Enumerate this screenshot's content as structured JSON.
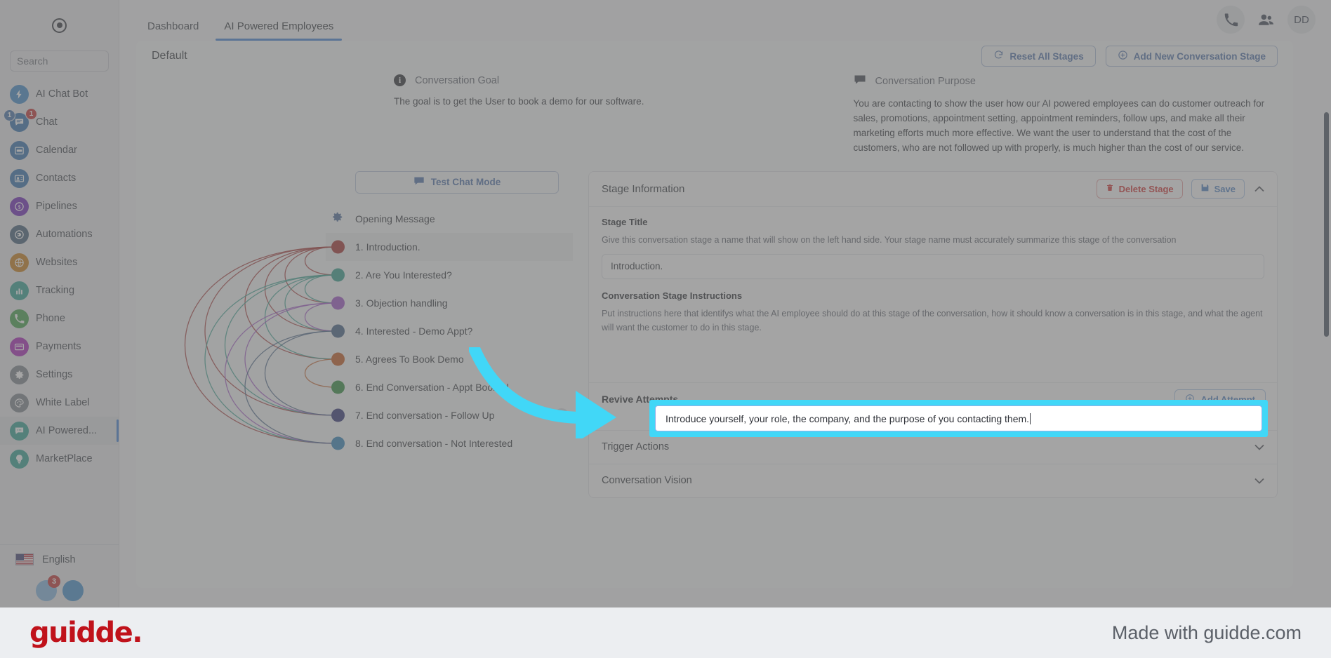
{
  "sidebar": {
    "search_placeholder": "Search",
    "logo_icon": "record-dot-icon",
    "items": [
      {
        "label": "AI Chat Bot",
        "icon": "bolt-icon",
        "color": "#3a86c8",
        "active": false
      },
      {
        "label": "Chat",
        "icon": "chat-bubble-icon",
        "color": "#2d6cab",
        "active": false,
        "badge_left": "1",
        "badge_right": "1"
      },
      {
        "label": "Calendar",
        "icon": "calendar-icon",
        "color": "#2d6cab",
        "active": false
      },
      {
        "label": "Contacts",
        "icon": "contact-card-icon",
        "color": "#2d6cab",
        "active": false
      },
      {
        "label": "Pipelines",
        "icon": "dollar-circle-icon",
        "color": "#6b21b6",
        "active": false
      },
      {
        "label": "Automations",
        "icon": "automation-icon",
        "color": "#3d5a74",
        "active": false
      },
      {
        "label": "Websites",
        "icon": "globe-icon",
        "color": "#c87a10",
        "active": false
      },
      {
        "label": "Tracking",
        "icon": "bar-chart-icon",
        "color": "#2a9d8f",
        "active": false
      },
      {
        "label": "Phone",
        "icon": "phone-icon",
        "color": "#3d9e46",
        "active": false
      },
      {
        "label": "Payments",
        "icon": "credit-card-icon",
        "color": "#a61fb5",
        "active": false
      },
      {
        "label": "Settings",
        "icon": "gear-icon",
        "color": "#7a8189",
        "active": false
      },
      {
        "label": "White Label",
        "icon": "palette-icon",
        "color": "#7a8189",
        "active": false
      },
      {
        "label": "AI Powered...",
        "icon": "chat-dots-icon",
        "color": "#2a9d8f",
        "active": true
      },
      {
        "label": "MarketPlace",
        "icon": "bulb-icon",
        "color": "#2a9d8f",
        "active": false
      }
    ],
    "language": "English",
    "language_flag": "us-flag-icon",
    "bottom_badge": "3"
  },
  "topbar": {
    "tabs": [
      {
        "label": "Dashboard",
        "active": false
      },
      {
        "label": "AI Powered Employees",
        "active": true
      }
    ],
    "phone_icon": "phone-icon",
    "people_icon": "people-icon",
    "avatar_initials": "DD"
  },
  "canvas": {
    "title": "Default",
    "reset_button": "Reset All Stages",
    "reset_icon": "refresh-icon",
    "add_stage_button": "Add New Conversation Stage",
    "add_stage_icon": "plus-circle-icon"
  },
  "goal": {
    "icon": "info-icon",
    "title": "Conversation Goal",
    "text": "The goal is to get the User to book a demo for our software."
  },
  "purpose": {
    "icon": "speech-bubble-icon",
    "title": "Conversation Purpose",
    "text": "You are contacting to show the user how our AI powered employees can do customer outreach for sales, promotions, appointment setting, appointment reminders, follow ups, and make all their marketing efforts much more effective. We want the user to understand that the cost of the customers, who are not followed up with properly, is much higher than the cost of our service."
  },
  "stages": {
    "test_chat_button": "Test Chat Mode",
    "test_chat_icon": "chat-bubble-icon",
    "opening": {
      "label": "Opening Message",
      "icon": "gear-icon"
    },
    "items": [
      {
        "label": "1. Introduction.",
        "color": "#a02a28",
        "selected": true
      },
      {
        "label": "2. Are You Interested?",
        "color": "#2d9c8a",
        "selected": false
      },
      {
        "label": "3. Objection handling",
        "color": "#9c4fc4",
        "selected": false
      },
      {
        "label": "4. Interested - Demo Appt?",
        "color": "#3d5c80",
        "selected": false
      },
      {
        "label": "5. Agrees To Book Demo",
        "color": "#c2561a",
        "selected": false
      },
      {
        "label": "6. End Conversation - Appt Booked",
        "color": "#2b8a38",
        "selected": false
      },
      {
        "label": "7. End conversation - Follow Up",
        "color": "#2c2d72",
        "selected": false,
        "bubble_icon": "chat-dots-icon"
      },
      {
        "label": "8. End conversation - Not Interested",
        "color": "#2d81b8",
        "selected": false
      }
    ]
  },
  "stage_info": {
    "panel_title": "Stage Information",
    "delete_button": "Delete Stage",
    "delete_icon": "trash-icon",
    "save_button": "Save",
    "save_icon": "floppy-disk-icon",
    "collapse_icon": "chevron-up-icon",
    "stage_title_label": "Stage Title",
    "stage_title_help": "Give this conversation stage a name that will show on the left hand side. Your stage name must accurately summarize this stage of the conversation",
    "stage_title_value": "Introduction.",
    "instructions_label": "Conversation Stage Instructions",
    "instructions_help": "Put instructions here that identifys what the AI employee should do at this stage of the conversation, how it should know a conversation is in this stage, and what the agent will want the customer to do in this stage.",
    "instructions_value": "Introduce yourself, your role, the company, and the purpose of you contacting them.",
    "revive_label": "Revive Attempts",
    "add_attempt_button": "Add Attempt",
    "add_attempt_icon": "plus-circle-icon",
    "trigger_actions_label": "Trigger Actions",
    "trigger_actions_icon": "chevron-down-icon",
    "conversation_vision_label": "Conversation Vision",
    "conversation_vision_icon": "chevron-down-icon"
  },
  "footer": {
    "logo_text": "guidde.",
    "made_with": "Made with guidde.com"
  },
  "highlight": {
    "color": "#41d7f7",
    "arrow_color": "#41d7f7"
  }
}
